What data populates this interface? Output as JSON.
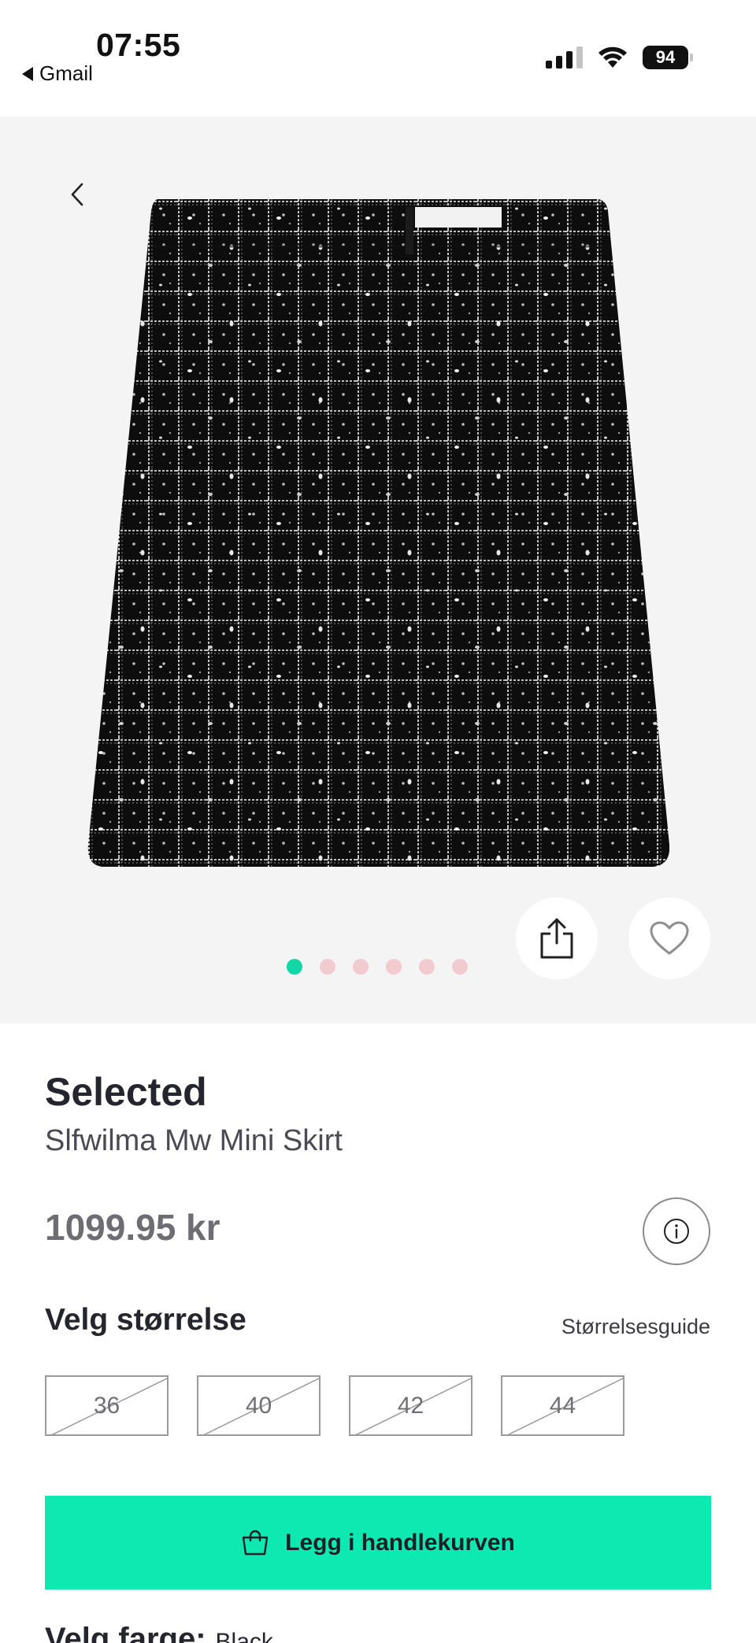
{
  "status_bar": {
    "time": "07:55",
    "back_app": "Gmail",
    "battery": "94"
  },
  "gallery": {
    "image_count": 6,
    "active_index": 0
  },
  "product": {
    "brand": "Selected",
    "name": "Slfwilma Mw Mini Skirt",
    "price": "1099.95 kr"
  },
  "sizes": {
    "title": "Velg størrelse",
    "guide_label": "Størrelsesguide",
    "options": [
      {
        "label": "36",
        "available": false
      },
      {
        "label": "40",
        "available": false
      },
      {
        "label": "42",
        "available": false
      },
      {
        "label": "44",
        "available": false
      }
    ]
  },
  "cart": {
    "label": "Legg i handlekurven"
  },
  "color": {
    "title": "Velg farge:",
    "value": "Black"
  },
  "colors": {
    "accent": "#0ee9b2",
    "dot_active": "#13d6a7",
    "dot_inactive": "#f2cbd1"
  }
}
